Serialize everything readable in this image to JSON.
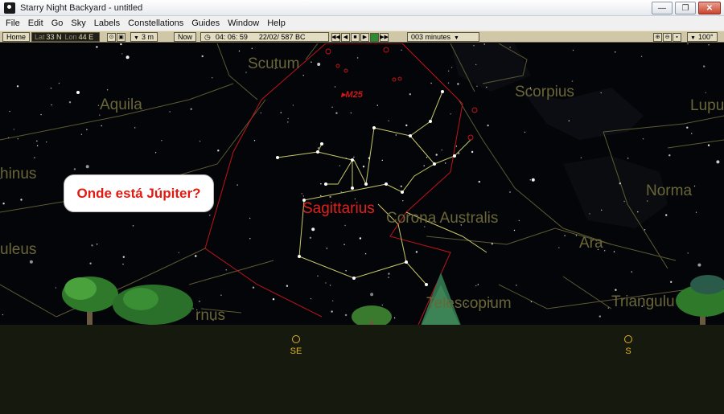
{
  "window": {
    "title": "Starry Night Backyard - untitled",
    "controls": [
      "minimize",
      "maximize",
      "close"
    ]
  },
  "menu": [
    "File",
    "Edit",
    "Go",
    "Sky",
    "Labels",
    "Constellations",
    "Guides",
    "Window",
    "Help"
  ],
  "toolbar": {
    "home_label": "Home",
    "lat_label": "Lat",
    "lat_value": "33 N",
    "lon_label": "Lon",
    "lon_value": "44 E",
    "elevation": "3 m",
    "now_label": "Now",
    "time": "04: 06: 59",
    "date": "22/02/ 587 BC",
    "time_step": "003 minutes",
    "fov": "100°",
    "icons": [
      "binoculars-icon",
      "lock-icon",
      "clock-icon",
      "rewind-icon",
      "step-back-icon",
      "stop-icon",
      "play-icon",
      "step-forward-icon",
      "zoom-in-icon",
      "zoom-out-icon",
      "zoom-box-icon"
    ]
  },
  "sky": {
    "constellations": [
      "Scutum",
      "Aquila",
      "Scorpius",
      "Lupu",
      "hinus",
      "Norma",
      "Corona Australis",
      "Ara",
      "uleus",
      "Telescopium",
      "Triangulu",
      "rnus"
    ],
    "highlighted_constellation": "Sagittarius",
    "deep_sky_label": "M25",
    "callout": "Onde está Júpiter?"
  },
  "horizon": {
    "markers": [
      "SE",
      "S"
    ]
  },
  "colors": {
    "boundary": "#c0141a",
    "constellation_lines": "#c9c86a",
    "constellation_names": "#6a6638",
    "highlight_name": "#e0201c",
    "ground": "#161a0e",
    "sky": "#040508"
  }
}
